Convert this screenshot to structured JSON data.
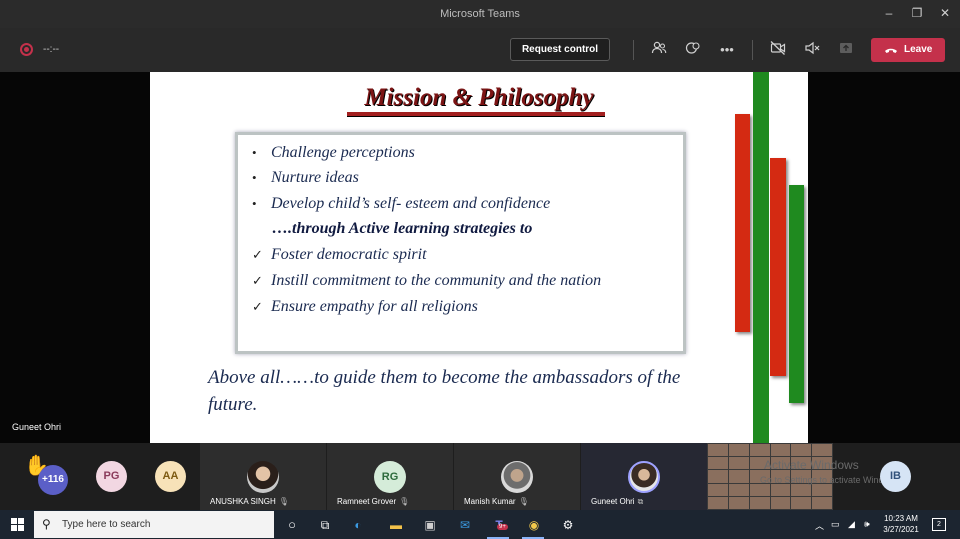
{
  "window": {
    "title": "Microsoft Teams"
  },
  "toolbar": {
    "timer": "--:--",
    "request_control": "Request control",
    "leave": "Leave"
  },
  "slide": {
    "title": "Mission & Philosophy",
    "bullets": [
      "Challenge perceptions",
      "Nurture ideas",
      "Develop child’s self- esteem and confidence"
    ],
    "subheading": "….through Active learning strategies to",
    "checks": [
      "Foster democratic spirit",
      "Instill commitment to the community and the nation",
      "Ensure empathy for all religions"
    ],
    "closing_line1": "Above all……to guide them to become the ambassadors of the",
    "closing_line2": "future.",
    "colors": {
      "red": "#d42a12",
      "green": "#1f8a1f",
      "title": "#7b1414"
    }
  },
  "speaker": {
    "name": "Guneet Ohri"
  },
  "participants": {
    "overflow_count": "+116",
    "small_avatars": [
      {
        "initials": "PG",
        "bg": "#f2d7e2",
        "fg": "#8a3a5a"
      },
      {
        "initials": "AA",
        "bg": "#f7e2b8",
        "fg": "#7d5a12"
      }
    ],
    "tiles": [
      {
        "name": "ANUSHKA SINGH",
        "initials": ""
      },
      {
        "name": "Ramneet Grover",
        "initials": "RG"
      },
      {
        "name": "Manish Kumar",
        "initials": ""
      },
      {
        "name": "Guneet Ohri",
        "initials": ""
      }
    ],
    "ib": {
      "initials": "IB"
    }
  },
  "watermark": {
    "line1": "Activate Windows",
    "line2": "Go to Settings to activate Windows."
  },
  "taskbar": {
    "search_placeholder": "Type here to search",
    "time": "10:23 AM",
    "date": "3/27/2021",
    "notifications": "2",
    "teams_badge": "9+"
  }
}
